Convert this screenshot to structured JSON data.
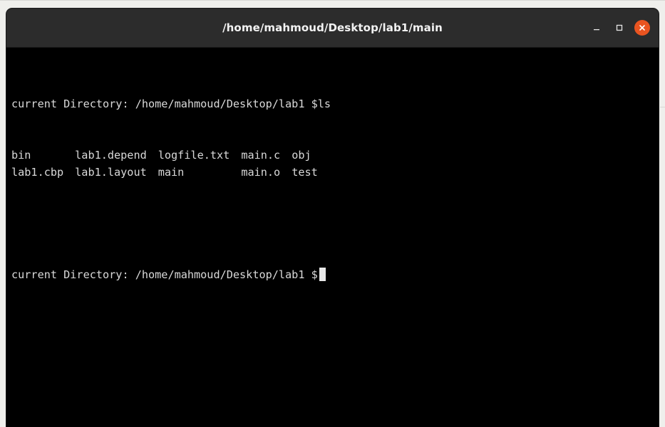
{
  "window": {
    "title": "/home/mahmoud/Desktop/lab1/main",
    "controls": {
      "minimize": "–",
      "maximize": "□",
      "close": "×"
    },
    "colors": {
      "titlebar": "#2c2c2c",
      "terminal_bg": "#000000",
      "terminal_fg": "#d9d9d9",
      "close_button": "#e95420"
    }
  },
  "terminal": {
    "prompt_1": "current Directory: /home/mahmoud/Desktop/lab1 $",
    "command_1": "ls",
    "ls_output": [
      [
        "bin",
        "lab1.depend",
        "logfile.txt",
        "main.c",
        "obj"
      ],
      [
        "lab1.cbp",
        "lab1.layout",
        "main",
        "main.o",
        "test"
      ]
    ],
    "prompt_2": "current Directory: /home/mahmoud/Desktop/lab1 $"
  }
}
